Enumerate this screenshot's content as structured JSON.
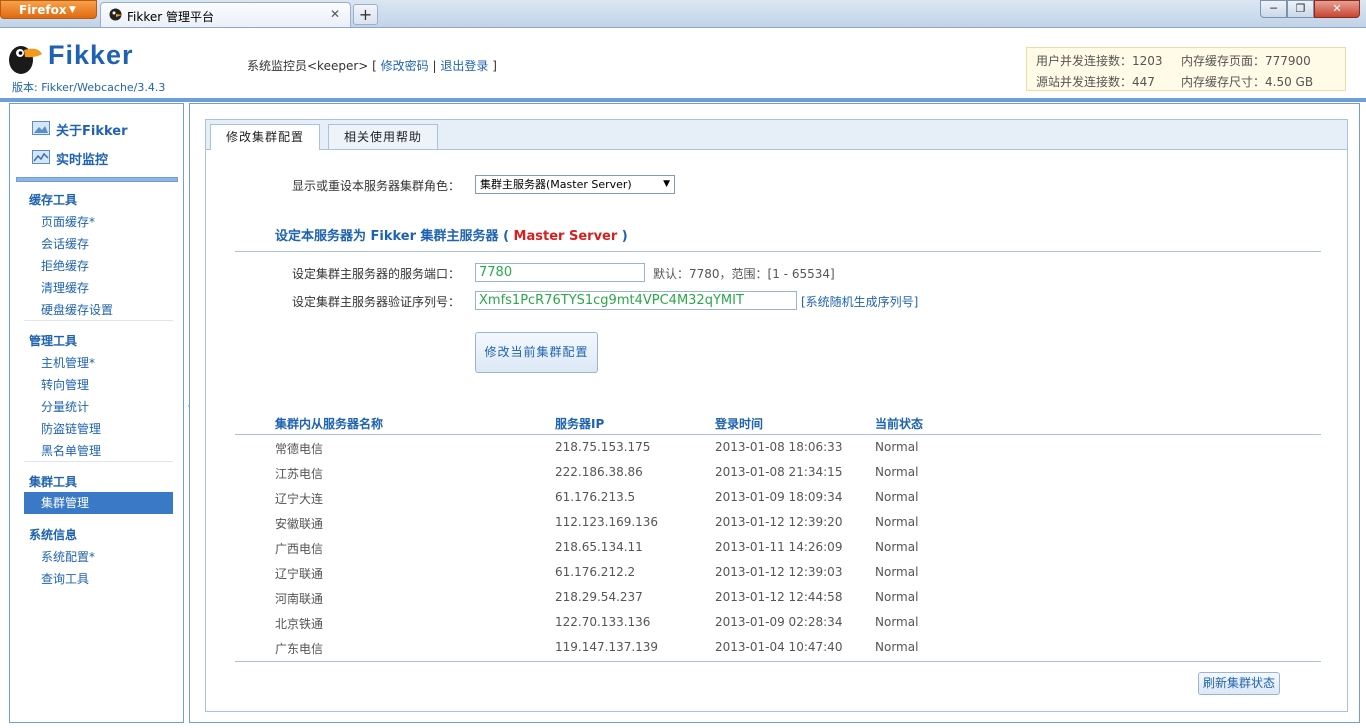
{
  "browser": {
    "menu_button": "Firefox",
    "tab_title": "Fikker 管理平台",
    "new_tab": "+",
    "win_min": "─",
    "win_max": "❐",
    "win_close": "✕"
  },
  "header": {
    "logo_text": "Fikker",
    "version": "版本: Fikker/Webcache/3.4.3",
    "user_prefix": "系统监控员<keeper> [",
    "change_password": "修改密码",
    "sep": "|",
    "logout": "退出登录",
    "user_suffix": "]",
    "stats": {
      "user_conn": "用户并发连接数：1203",
      "mem_pages": "内存缓存页面：777900",
      "origin_conn": "源站并发连接数：447",
      "mem_size": "内存缓存尺寸：4.50 GB"
    }
  },
  "sidebar": {
    "top_links": [
      {
        "label": "关于Fikker"
      },
      {
        "label": "实时监控"
      }
    ],
    "groups": [
      {
        "title": "缓存工具",
        "items": [
          "页面缓存*",
          "会话缓存",
          "拒绝缓存",
          "清理缓存",
          "硬盘缓存设置"
        ]
      },
      {
        "title": "管理工具",
        "items": [
          "主机管理*",
          "转向管理",
          "分量统计",
          "防盗链管理",
          "黑名单管理"
        ]
      },
      {
        "title": "集群工具",
        "items": [
          "集群管理"
        ]
      },
      {
        "title": "系统信息",
        "items": [
          "系统配置*",
          "查询工具"
        ]
      }
    ]
  },
  "main": {
    "tabs": [
      "修改集群配置",
      "相关使用帮助"
    ],
    "role_label": "显示或重设本服务器集群角色：",
    "role_value": "集群主服务器(Master Server)",
    "subtitle_prefix": "设定本服务器为 Fikker 集群主服务器 (",
    "subtitle_red": " Master Server ",
    "subtitle_suffix": ")",
    "port_label": "设定集群主服务器的服务端口：",
    "port_value": "7780",
    "port_hint": "默认：7780，范围：[1 - 65534]",
    "serial_label": "设定集群主服务器验证序列号：",
    "serial_value": "Xmfs1PcR76TYS1cg9mt4VPC4M32qYMIT",
    "serial_link": "[系统随机生成序列号]",
    "submit_button": "修改当前集群配置",
    "refresh_button": "刷新集群状态",
    "table": {
      "headers": [
        "集群内从服务器名称",
        "服务器IP",
        "登录时间",
        "当前状态"
      ],
      "rows": [
        [
          "常德电信",
          "218.75.153.175",
          "2013-01-08 18:06:33",
          "Normal"
        ],
        [
          "江苏电信",
          "222.186.38.86",
          "2013-01-08 21:34:15",
          "Normal"
        ],
        [
          "辽宁大连",
          "61.176.213.5",
          "2013-01-09 18:09:34",
          "Normal"
        ],
        [
          "安徽联通",
          "112.123.169.136",
          "2013-01-12 12:39:20",
          "Normal"
        ],
        [
          "广西电信",
          "218.65.134.11",
          "2013-01-11 14:26:09",
          "Normal"
        ],
        [
          "辽宁联通",
          "61.176.212.2",
          "2013-01-12 12:39:03",
          "Normal"
        ],
        [
          "河南联通",
          "218.29.54.237",
          "2013-01-12 12:44:58",
          "Normal"
        ],
        [
          "北京铁通",
          "122.70.133.136",
          "2013-01-09 02:28:34",
          "Normal"
        ],
        [
          "广东电信",
          "119.147.137.139",
          "2013-01-04 10:47:40",
          "Normal"
        ]
      ]
    }
  },
  "colors": {
    "accent": "#1f63b0",
    "highlight_red": "#d42020",
    "input_text": "#2aa84a",
    "active_item": "#3a79c6"
  }
}
